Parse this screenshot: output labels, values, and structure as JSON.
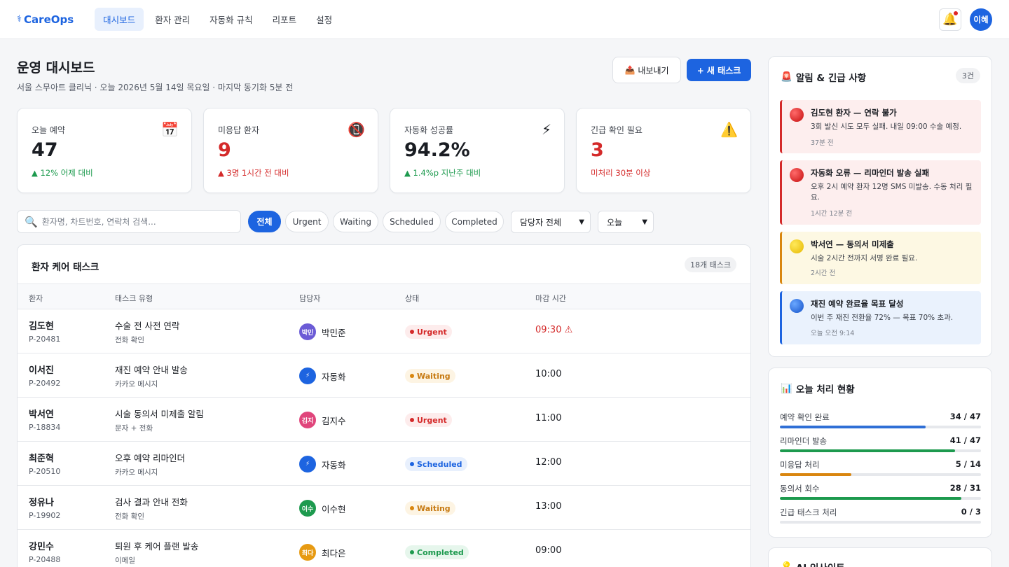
{
  "nav": {
    "logo": "CareOps",
    "logo_icon": "⚕",
    "tabs": [
      {
        "label": "대시보드",
        "active": true
      },
      {
        "label": "환자 관리",
        "active": false
      },
      {
        "label": "자동화 규칙",
        "active": false
      },
      {
        "label": "리포트",
        "active": false
      },
      {
        "label": "설정",
        "active": false
      }
    ],
    "user_initials": "이혜"
  },
  "header": {
    "title": "운영 대시보드",
    "subtitle": "서울 스무아트 클리닉 · 오늘 2026년 5월 14일 목요일 · 마지막 동기화 5분 전",
    "export_label": "내보내기",
    "new_task_label": "+ 새 태스크"
  },
  "stats": [
    {
      "label": "오늘 예약",
      "icon": "📅",
      "icon_name": "calendar-icon",
      "value": "47",
      "delta": "▲ 12% 어제 대비",
      "tone": "normal"
    },
    {
      "label": "미응답 환자",
      "icon": "📵",
      "icon_name": "no-phone-icon",
      "value": "9",
      "delta": "▲ 3명 1시간 전 대비",
      "tone": "red"
    },
    {
      "label": "자동화 성공률",
      "icon": "⚡",
      "icon_name": "lightning-icon",
      "value": "94.2%",
      "delta": "▲ 1.4%p 지난주 대비",
      "tone": "normal"
    },
    {
      "label": "긴급 확인 필요",
      "icon": "⚠️",
      "icon_name": "warning-icon",
      "value": "3",
      "delta": "미처리 30분 이상",
      "tone": "red"
    }
  ],
  "filters": {
    "search_placeholder": "환자명, 차트번호, 연락처 검색...",
    "chips": [
      {
        "label": "전체",
        "active": true
      },
      {
        "label": "Urgent",
        "active": false
      },
      {
        "label": "Waiting",
        "active": false
      },
      {
        "label": "Scheduled",
        "active": false
      },
      {
        "label": "Completed",
        "active": false
      }
    ],
    "owner_select": "담당자 전체",
    "date_select": "오늘"
  },
  "tasks": {
    "title": "환자 케어 태스크",
    "count": "18개 태스크",
    "columns": [
      "환자",
      "태스크 유형",
      "담당자",
      "상태",
      "마감 시간"
    ],
    "rows": [
      {
        "name": "김도현",
        "id": "P-20481",
        "type": "수술 전 사전 연락",
        "channel": "전화 확인",
        "owner": "박민준",
        "owner_initials": "박민",
        "owner_color": "#6b5bd6",
        "status": "Urgent",
        "status_class": "urgent",
        "due": "09:30 ⚠",
        "overdue": true
      },
      {
        "name": "이서진",
        "id": "P-20492",
        "type": "재진 예약 안내 발송",
        "channel": "카카오 메시지",
        "owner": "자동화",
        "owner_initials": "⚡",
        "owner_color": "#1d64e0",
        "status": "Waiting",
        "status_class": "waiting",
        "due": "10:00",
        "overdue": false
      },
      {
        "name": "박서연",
        "id": "P-18834",
        "type": "시술 동의서 미제출 알림",
        "channel": "문자 + 전화",
        "owner": "김지수",
        "owner_initials": "김지",
        "owner_color": "#e0457b",
        "status": "Urgent",
        "status_class": "urgent",
        "due": "11:00",
        "overdue": false
      },
      {
        "name": "최준혁",
        "id": "P-20510",
        "type": "오후 예약 리마인더",
        "channel": "카카오 메시지",
        "owner": "자동화",
        "owner_initials": "⚡",
        "owner_color": "#1d64e0",
        "status": "Scheduled",
        "status_class": "scheduled",
        "due": "12:00",
        "overdue": false
      },
      {
        "name": "정유나",
        "id": "P-19902",
        "type": "검사 결과 안내 전화",
        "channel": "전화 확인",
        "owner": "이수현",
        "owner_initials": "이수",
        "owner_color": "#1d9a4e",
        "status": "Waiting",
        "status_class": "waiting",
        "due": "13:00",
        "overdue": false
      },
      {
        "name": "강민수",
        "id": "P-20488",
        "type": "퇴원 후 케어 플랜 발송",
        "channel": "이메일",
        "owner": "최다은",
        "owner_initials": "최다",
        "owner_color": "#e79a12",
        "status": "Completed",
        "status_class": "completed",
        "due": "09:00",
        "overdue": false
      }
    ]
  },
  "alerts": {
    "title": "알림 & 긴급 사항",
    "icon": "🚨",
    "count": "3건",
    "items": [
      {
        "title": "김도현 환자 — 연락 불가",
        "desc": "3회 발신 시도 모두 실패. 내일 09:00 수술 예정.",
        "time": "37분 전",
        "tone": "red"
      },
      {
        "title": "자동화 오류 — 리마인더 발송 실패",
        "desc": "오후 2시 예약 환자 12명 SMS 미발송. 수동 처리 필요.",
        "time": "1시간 12분 전",
        "tone": "red"
      },
      {
        "title": "박서연 — 동의서 미제출",
        "desc": "시술 2시간 전까지 서명 완료 필요.",
        "time": "2시간 전",
        "tone": "yellow"
      },
      {
        "title": "재진 예약 완료율 목표 달성",
        "desc": "이번 주 재진 전환율 72% — 목표 70% 초과.",
        "time": "오늘 오전 9:14",
        "tone": "blue"
      }
    ]
  },
  "progress": {
    "title": "오늘 처리 현황",
    "icon": "📊",
    "items": [
      {
        "label": "예약 확인 완료",
        "value": "34 / 47",
        "fraction": 0.723,
        "color": "#2f6fd6"
      },
      {
        "label": "리마인더 발송",
        "value": "41 / 47",
        "fraction": 0.872,
        "color": "#1d9a4e"
      },
      {
        "label": "미응답 처리",
        "value": "5 / 14",
        "fraction": 0.357,
        "color": "#d9860f"
      },
      {
        "label": "동의서 회수",
        "value": "28 / 31",
        "fraction": 0.903,
        "color": "#1d9a4e"
      },
      {
        "label": "긴급 태스크 처리",
        "value": "0 / 3",
        "fraction": 0.0,
        "color": "#d42a2a"
      }
    ]
  },
  "ai": {
    "title": "AI 인사이트",
    "icon": "💡"
  }
}
